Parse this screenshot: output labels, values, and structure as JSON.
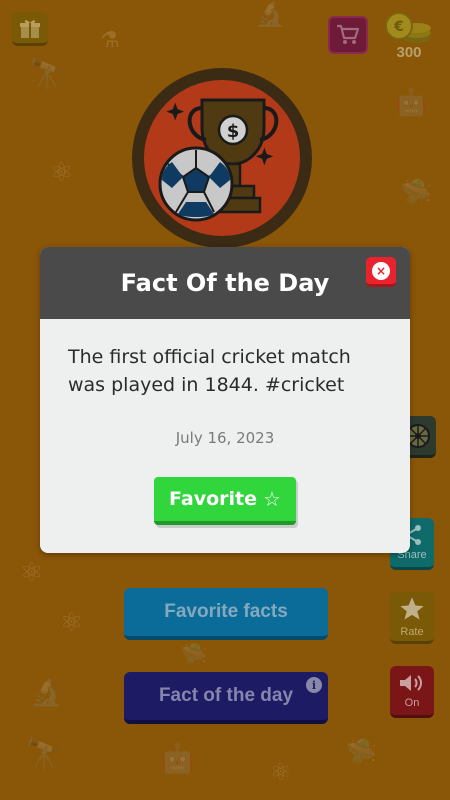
{
  "colors": {
    "background": "#8a5608",
    "modal_header": "#4a4a4a",
    "modal_body": "#eef0ef",
    "favorite_green": "#31d63d",
    "close_red": "#e8232d"
  },
  "topbar": {
    "coin_count": "300",
    "icons": [
      "gift-icon",
      "cart-icon",
      "coins-icon"
    ]
  },
  "emblem": {
    "icon": "trophy-soccer-icon"
  },
  "modal": {
    "title": "Fact Of the Day",
    "fact_text": "The first official cricket match was played in 1844. #cricket",
    "date": "July 16, 2023",
    "favorite_label": "Favorite",
    "favorite_star": "☆",
    "close_symbol": "×"
  },
  "menu": {
    "favorite_facts_label": "Favorite facts",
    "fact_of_the_day_label": "Fact of the day",
    "info_symbol": "i"
  },
  "side": {
    "share_label": "Share",
    "rate_label": "Rate",
    "sound_label": "On"
  }
}
